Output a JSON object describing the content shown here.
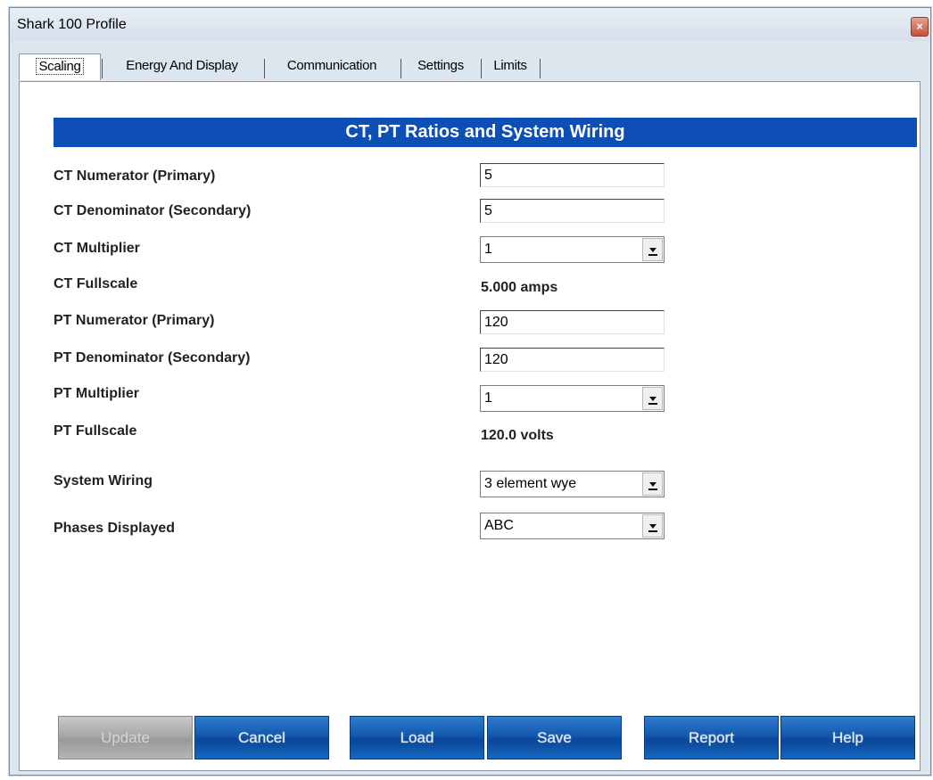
{
  "window": {
    "title": "Shark 100 Profile",
    "close_glyph": "×"
  },
  "tabs": [
    {
      "label": "Scaling",
      "active": true
    },
    {
      "label": "Energy And Display",
      "active": false
    },
    {
      "label": "Communication",
      "active": false
    },
    {
      "label": "Settings",
      "active": false
    },
    {
      "label": "Limits",
      "active": false
    }
  ],
  "section": {
    "title": "CT, PT Ratios and System Wiring"
  },
  "fields": {
    "ct_numerator": {
      "label": "CT Numerator (Primary)",
      "value": "5"
    },
    "ct_denominator": {
      "label": "CT Denominator (Secondary)",
      "value": "5"
    },
    "ct_multiplier": {
      "label": "CT Multiplier",
      "value": "1"
    },
    "ct_fullscale": {
      "label": "CT Fullscale",
      "value": "5.000  amps"
    },
    "pt_numerator": {
      "label": "PT Numerator (Primary)",
      "value": "120"
    },
    "pt_denominator": {
      "label": "PT Denominator (Secondary)",
      "value": "120"
    },
    "pt_multiplier": {
      "label": "PT Multiplier",
      "value": "1"
    },
    "pt_fullscale": {
      "label": "PT Fullscale",
      "value": "120.0  volts"
    },
    "system_wiring": {
      "label": "System Wiring",
      "value": "3 element wye"
    },
    "phases_displayed": {
      "label": "Phases Displayed",
      "value": "ABC"
    }
  },
  "buttons": {
    "update": "Update",
    "cancel": "Cancel",
    "load": "Load",
    "save": "Save",
    "report": "Report",
    "help": "Help"
  },
  "colors": {
    "section_header": "#0d4fb4",
    "button_blue": "#1358ad",
    "button_disabled": "#a8a8a8",
    "close_red": "#c4513a"
  }
}
